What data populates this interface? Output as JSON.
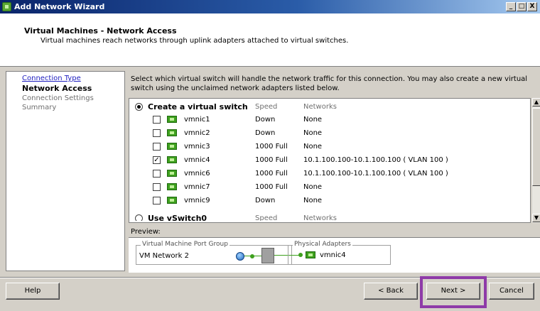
{
  "window": {
    "title": "Add Network Wizard",
    "controls": [
      "_",
      "□",
      "X"
    ]
  },
  "header": {
    "title": "Virtual Machines - Network Access",
    "subtitle": "Virtual machines reach networks through uplink adapters attached to virtual switches."
  },
  "nav": {
    "items": [
      {
        "label": "Connection Type"
      },
      {
        "label": "Network Access"
      },
      {
        "label": "Connection Settings"
      },
      {
        "label": "Summary"
      }
    ]
  },
  "instruction": "Select which virtual switch will handle the network traffic for this connection. You may also create a new virtual switch using the unclaimed network adapters listed below.",
  "switch_options": {
    "create_label": "Create a virtual switch",
    "speed_header": "Speed",
    "networks_header": "Networks",
    "use_label_partial": "Use vSwitch0",
    "speed_header_2": "Speed",
    "networks_header_2": "Networks",
    "adapters": [
      {
        "name": "vmnic1",
        "checked": false,
        "speed": "Down",
        "networks": "None"
      },
      {
        "name": "vmnic2",
        "checked": false,
        "speed": "Down",
        "networks": "None"
      },
      {
        "name": "vmnic3",
        "checked": false,
        "speed": "1000 Full",
        "networks": "None"
      },
      {
        "name": "vmnic4",
        "checked": true,
        "speed": "1000 Full",
        "networks": "10.1.100.100-10.1.100.100 ( VLAN 100 )"
      },
      {
        "name": "vmnic6",
        "checked": false,
        "speed": "1000 Full",
        "networks": "10.1.100.100-10.1.100.100 ( VLAN 100 )"
      },
      {
        "name": "vmnic7",
        "checked": false,
        "speed": "1000 Full",
        "networks": "None"
      },
      {
        "name": "vmnic9",
        "checked": false,
        "speed": "Down",
        "networks": "None"
      }
    ]
  },
  "preview": {
    "label": "Preview:",
    "port_group_legend": "Virtual Machine Port Group",
    "port_group_value": "VM Network 2",
    "physical_legend": "Physical Adapters",
    "physical_value": "vmnic4"
  },
  "buttons": {
    "help": "Help",
    "back": "< Back",
    "next": "Next >",
    "cancel": "Cancel"
  },
  "colors": {
    "highlight": "#8e3aa8",
    "nic_icon": "#3ea01e",
    "link": "#2020c0"
  }
}
